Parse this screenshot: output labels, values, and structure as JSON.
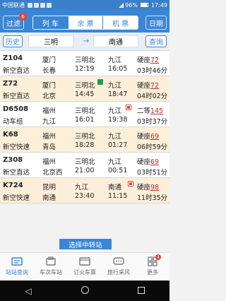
{
  "status_bar": {
    "carrier": "中国联通",
    "battery": "96%",
    "time": "17:49"
  },
  "header": {
    "transfer_btn": "过滤",
    "badge": "6",
    "tabs": [
      {
        "label": "列 车",
        "active": true
      },
      {
        "label": "余 票",
        "active": false
      },
      {
        "label": "机 票",
        "active": false
      }
    ],
    "date_btn": "日期"
  },
  "stations": {
    "history_btn": "历史",
    "from": "三明",
    "to": "南通",
    "search_btn": "查询",
    "arrow": "→"
  },
  "trains": [
    {
      "train": "Z104",
      "type": "新空直达",
      "from": "厦门",
      "to": "长春",
      "station": "三明北",
      "dep": "12:19",
      "station2": "九江",
      "arr": "16:05",
      "seat": "硬座",
      "count": "72",
      "duration": "03时46分"
    },
    {
      "train": "Z72",
      "type": "新空直达",
      "from": "厦门",
      "to": "北京",
      "station": "三明北",
      "dep": "14:45",
      "station2": "九江",
      "arr": "18:47",
      "seat": "硬座",
      "count": "72",
      "duration": "04时02分"
    },
    {
      "train": "D6508",
      "type": "动车组",
      "from": "福州",
      "to": "九江",
      "station": "三明北",
      "dep": "16:01",
      "station2": "九江",
      "arr": "19:38",
      "seat": "二等",
      "count": "145",
      "duration": "03时37分"
    },
    {
      "train": "K68",
      "type": "新空快速",
      "from": "福州",
      "to": "青岛",
      "station": "三明北",
      "dep": "18:28",
      "station2": "九江",
      "arr": "01:27",
      "seat": "硬座",
      "count": "69",
      "duration": "06时59分"
    },
    {
      "train": "Z308",
      "type": "新空直达",
      "from": "福州",
      "to": "北京西",
      "station": "三明北",
      "dep": "21:00",
      "station2": "九江",
      "arr": "00:51",
      "seat": "硬座",
      "count": "69",
      "duration": "03时51分"
    },
    {
      "train": "K724",
      "type": "新空快速",
      "from": "昆明",
      "to": "南通",
      "station": "九江",
      "dep": "23:40",
      "station2": "南通",
      "arr": "11:15",
      "seat": "硬座",
      "count": "98",
      "duration": "11时35分"
    }
  ],
  "transfer_button": "选择中转站",
  "bottom_nav": [
    {
      "label": "站站查询",
      "icon": "search-station-icon",
      "active": true
    },
    {
      "label": "车次车站",
      "icon": "train-station-icon",
      "active": false
    },
    {
      "label": "订火车票",
      "icon": "ticket-icon",
      "active": false
    },
    {
      "label": "旅行采风",
      "icon": "chat-icon",
      "active": false
    },
    {
      "label": "更多",
      "icon": "grid-icon",
      "active": false
    }
  ],
  "more_badge": "4",
  "colors": {
    "primary": "#3a86d4",
    "row_alt": "#fcefd9",
    "count": "#c22b2b"
  }
}
